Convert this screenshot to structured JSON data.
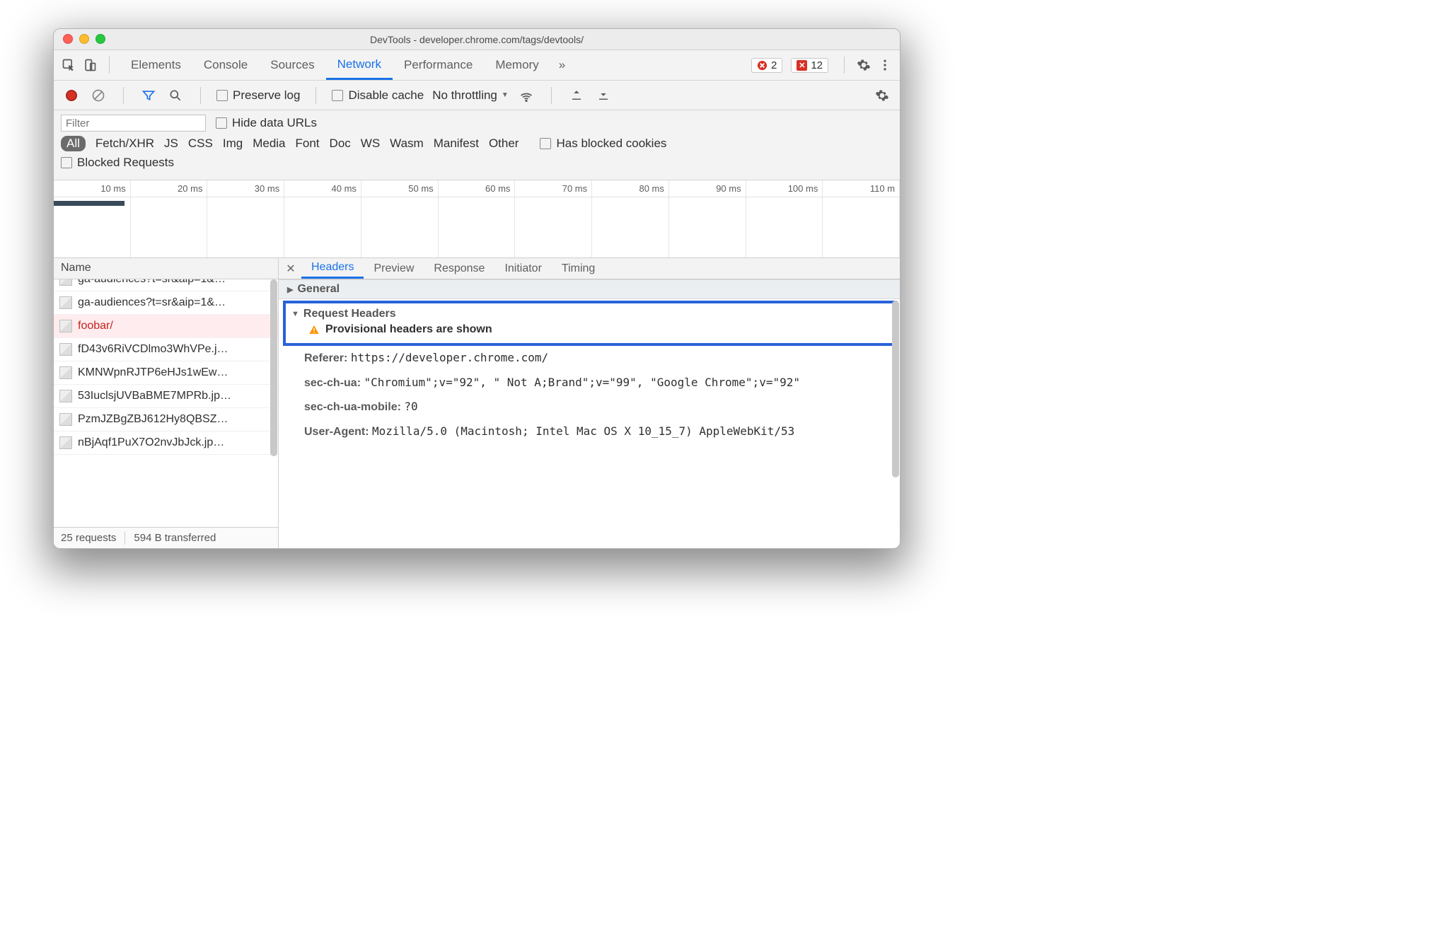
{
  "window": {
    "title": "DevTools - developer.chrome.com/tags/devtools/"
  },
  "main_tabs": [
    "Elements",
    "Console",
    "Sources",
    "Network",
    "Performance",
    "Memory"
  ],
  "main_tabs_more": "»",
  "active_main_tab": "Network",
  "error_badge": "2",
  "issue_badge": "12",
  "net_toolbar": {
    "preserve_log": "Preserve log",
    "disable_cache": "Disable cache",
    "throttling": "No throttling"
  },
  "filter": {
    "placeholder": "Filter",
    "hide_data_urls": "Hide data URLs",
    "types": [
      "All",
      "Fetch/XHR",
      "JS",
      "CSS",
      "Img",
      "Media",
      "Font",
      "Doc",
      "WS",
      "Wasm",
      "Manifest",
      "Other"
    ],
    "has_blocked_cookies": "Has blocked cookies",
    "blocked_requests": "Blocked Requests"
  },
  "timeline_labels": [
    "10 ms",
    "20 ms",
    "30 ms",
    "40 ms",
    "50 ms",
    "60 ms",
    "70 ms",
    "80 ms",
    "90 ms",
    "100 ms",
    "110 m"
  ],
  "requests": {
    "column": "Name",
    "items": [
      {
        "name": "ga-audiences?t=sr&aip=1&…",
        "err": false
      },
      {
        "name": "ga-audiences?t=sr&aip=1&…",
        "err": false
      },
      {
        "name": "foobar/",
        "err": true
      },
      {
        "name": "fD43v6RiVCDlmo3WhVPe.j…",
        "err": false
      },
      {
        "name": "KMNWpnRJTP6eHJs1wEw…",
        "err": false
      },
      {
        "name": "53IuclsjUVBaBME7MPRb.jp…",
        "err": false
      },
      {
        "name": "PzmJZBgZBJ612Hy8QBSZ…",
        "err": false
      },
      {
        "name": "nBjAqf1PuX7O2nvJbJck.jp…",
        "err": false
      }
    ],
    "status": {
      "count": "25 requests",
      "xfer": "594 B transferred"
    }
  },
  "detail": {
    "tabs": [
      "Headers",
      "Preview",
      "Response",
      "Initiator",
      "Timing"
    ],
    "active": "Headers",
    "general": "General",
    "req_headers": "Request Headers",
    "provisional": "Provisional headers are shown",
    "headers": [
      {
        "k": "Referer:",
        "v": "https://developer.chrome.com/"
      },
      {
        "k": "sec-ch-ua:",
        "v": "\"Chromium\";v=\"92\", \" Not A;Brand\";v=\"99\", \"Google Chrome\";v=\"92\""
      },
      {
        "k": "sec-ch-ua-mobile:",
        "v": "?0"
      },
      {
        "k": "User-Agent:",
        "v": "Mozilla/5.0 (Macintosh; Intel Mac OS X 10_15_7) AppleWebKit/53"
      }
    ]
  }
}
